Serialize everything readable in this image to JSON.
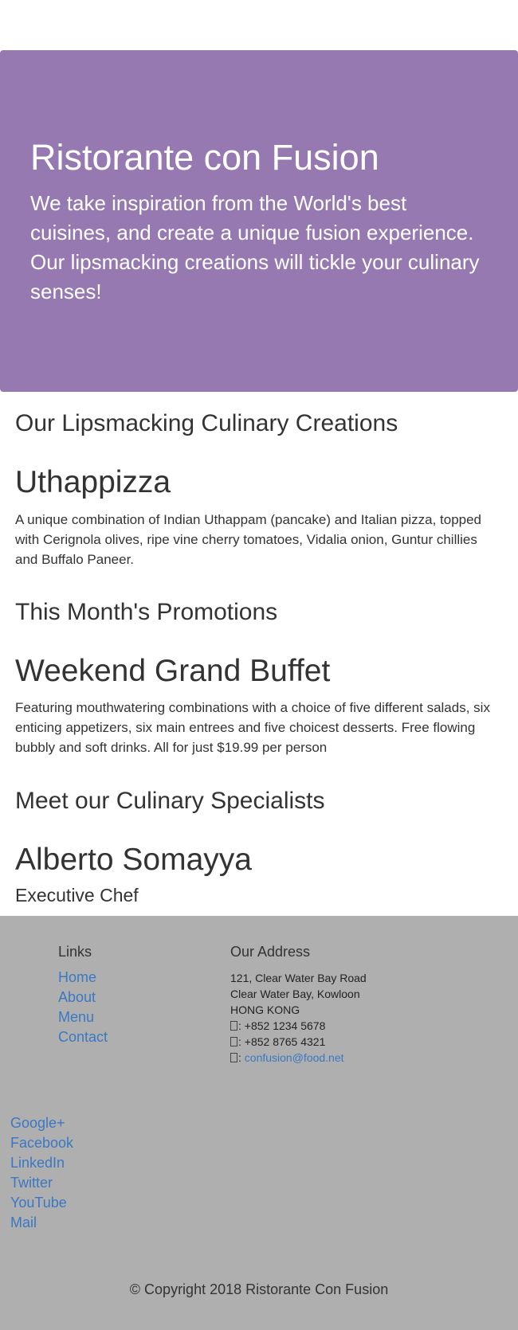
{
  "jumbotron": {
    "title": "Ristorante con Fusion",
    "lead": "We take inspiration from the World's best cuisines, and create a unique fusion experience. Our lipsmacking creations will tickle your culinary senses!"
  },
  "dish": {
    "heading": "Our Lipsmacking Culinary Creations",
    "name": "Uthappizza",
    "description": "A unique combination of Indian Uthappam (pancake) and Italian pizza, topped with Cerignola olives, ripe vine cherry tomatoes, Vidalia onion, Guntur chillies and Buffalo Paneer."
  },
  "promotion": {
    "heading": "This Month's Promotions",
    "name": "Weekend Grand Buffet",
    "description": "Featuring mouthwatering combinations with a choice of five different salads, six enticing appetizers, six main entrees and five choicest desserts. Free flowing bubbly and soft drinks. All for just $19.99 per person"
  },
  "leader": {
    "heading": "Meet our Culinary Specialists",
    "name": "Alberto Somayya",
    "designation": "Executive Chef"
  },
  "footer": {
    "links_heading": "Links",
    "links": [
      "Home",
      "About",
      "Menu",
      "Contact"
    ],
    "address_heading": "Our Address",
    "address_lines": [
      "121, Clear Water Bay Road",
      "Clear Water Bay, Kowloon",
      "HONG KONG"
    ],
    "phone": ": +852 1234 5678",
    "fax": ": +852 8765 4321",
    "email_prefix": ": ",
    "email": "confusion@food.net",
    "icons": [
      "phone-icon",
      "fax-icon",
      "envelope-icon"
    ],
    "social": [
      "Google+",
      "Facebook",
      "LinkedIn",
      "Twitter",
      "YouTube",
      "Mail"
    ],
    "copyright": "© Copyright 2018 Ristorante Con Fusion"
  },
  "colors": {
    "jumbotron_bg": "#9579b0",
    "footer_bg": "#afafaf",
    "link": "#3a78c4"
  }
}
